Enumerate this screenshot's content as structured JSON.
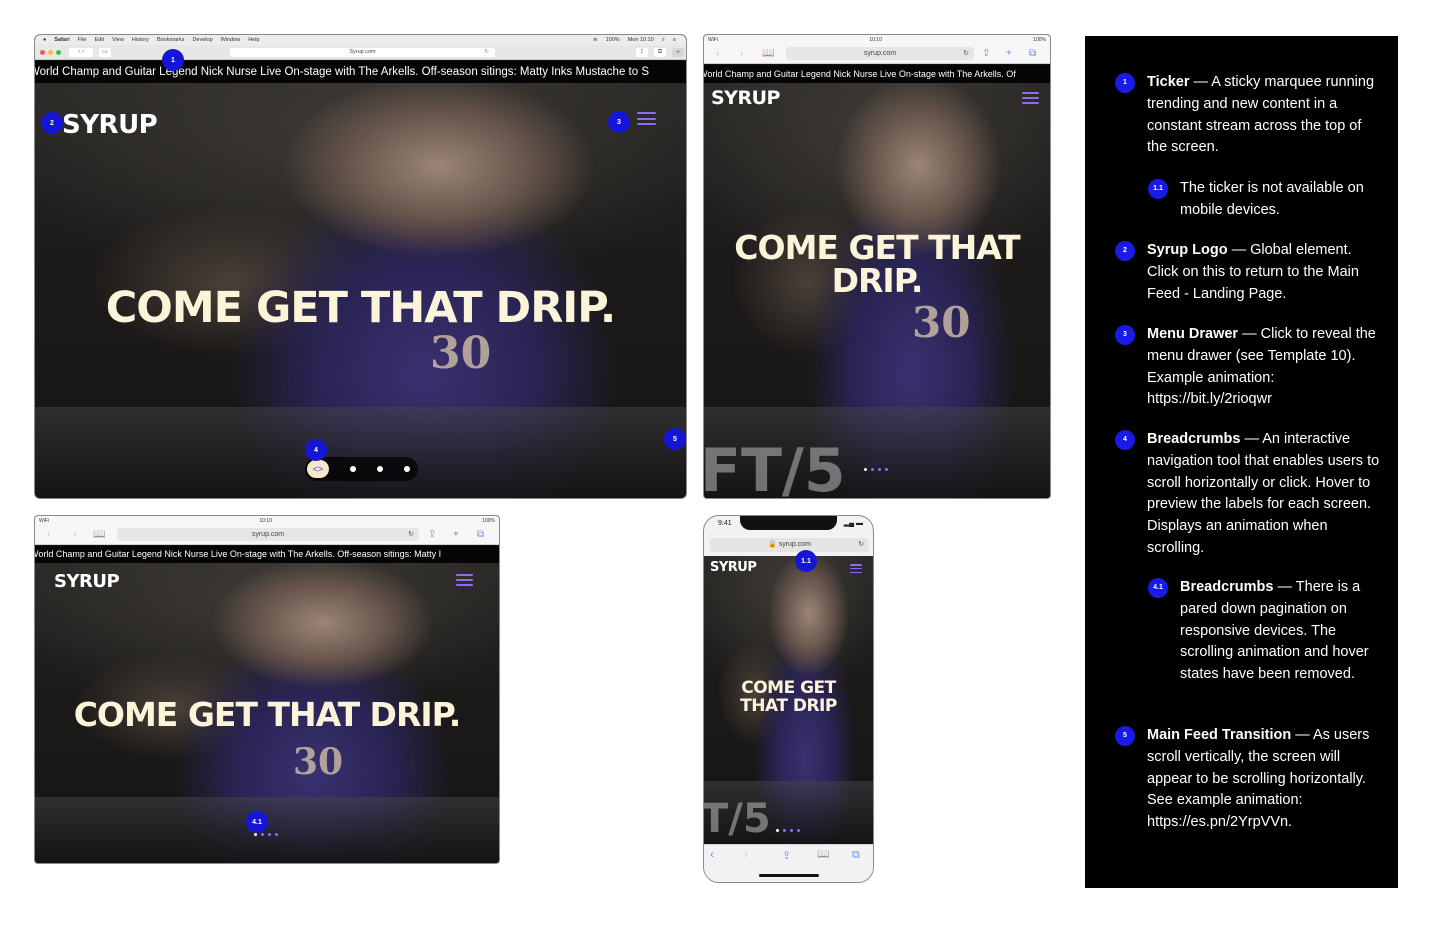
{
  "desktop": {
    "menu": [
      "Safari",
      "File",
      "Edit",
      "View",
      "History",
      "Bookmarks",
      "Develop",
      "Window",
      "Help"
    ],
    "status_battery": "100%",
    "clock": "Mon 10:10",
    "url": "Syrup.com",
    "ticker": "World Champ and Guitar Legend Nick Nurse Live On-stage with The Arkells.   Off-season sitings: Matty Inks Mustache to S",
    "logo": "SYRUP",
    "headline": "COME GET THAT DRIP.",
    "jersey": "30",
    "breadcrumb_glyph": "<>"
  },
  "tablet_landscape": {
    "carrier": "WiFi",
    "time": "10:10",
    "battery": "100%",
    "url": "syrup.com",
    "ticker": "World Champ and Guitar Legend Nick Nurse Live On-stage with The Arkells.  Of",
    "logo": "SYRUP",
    "headline_l1": "COME GET THAT",
    "headline_l2": "DRIP.",
    "jersey": "30",
    "sign": "FT/5"
  },
  "tablet_portrait": {
    "carrier": "WiFi",
    "time": "10:10",
    "battery": "100%",
    "url": "syrup.com",
    "ticker": "World Champ and Guitar Legend Nick Nurse Live On-stage with The Arkells.   Off-season sitings: Matty I",
    "logo": "SYRUP",
    "headline": "COME GET THAT DRIP.",
    "jersey": "30"
  },
  "phone": {
    "time": "9:41",
    "url": "syrup.com",
    "logo": "SYRUP",
    "headline_l1": "COME GET",
    "headline_l2": "THAT DRIP",
    "sign": "T/5"
  },
  "badges": {
    "b1": "1",
    "b2": "2",
    "b3": "3",
    "b4": "4",
    "b5": "5",
    "b11": "1.1",
    "b41": "4.1"
  },
  "notes": {
    "n1": {
      "num": "1",
      "title": "Ticker",
      "text": " — A sticky marquee running trending and new content in a constant stream across the top of the screen."
    },
    "n11": {
      "num": "1.1",
      "title": "",
      "text": "The ticker is not available on mobile devices."
    },
    "n2": {
      "num": "2",
      "title": "Syrup Logo",
      "text": " — Global element. Click on this to return to the Main Feed - Landing Page."
    },
    "n3": {
      "num": "3",
      "title": "Menu Drawer",
      "text": " — Click to reveal the menu drawer (see Template 10). Example animation: https://bit.ly/2rioqwr"
    },
    "n4": {
      "num": "4",
      "title": "Breadcrumbs",
      "text": " — An interactive navigation tool that enables users to scroll horizontally or click. Hover to preview the labels for each screen. Displays an animation when scrolling."
    },
    "n41": {
      "num": "4.1",
      "title": "Breadcrumbs",
      "text": " — There is a pared down pagination on responsive devices. The scrolling animation and hover states have been removed."
    },
    "n5": {
      "num": "5",
      "title": "Main Feed Transition",
      "text": " — As users scroll vertically, the screen will appear to be scrolling horizontally. See example animation: https://es.pn/2YrpVVn."
    }
  }
}
